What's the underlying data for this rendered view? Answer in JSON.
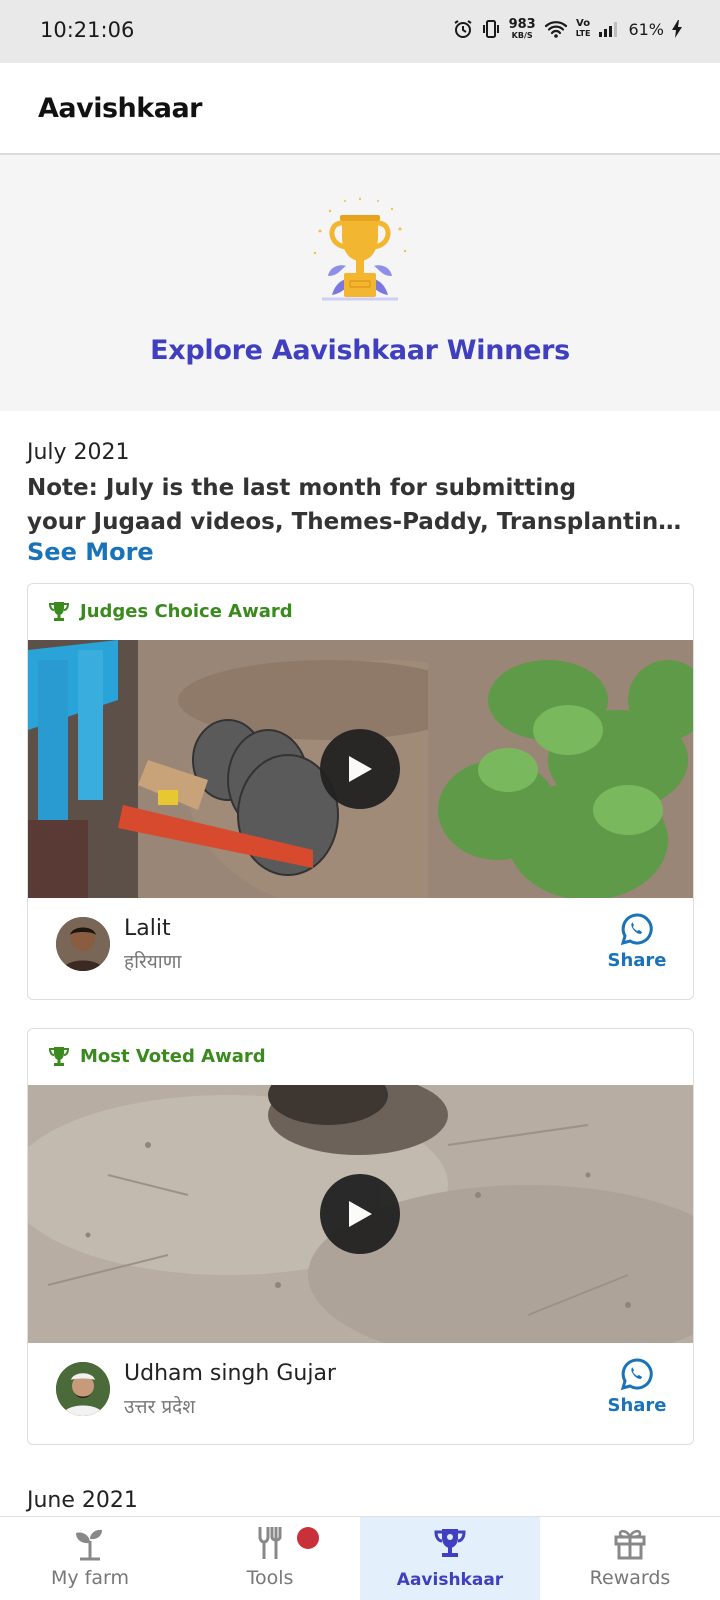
{
  "status_bar": {
    "time": "10:21:06",
    "speed_value": "983",
    "speed_unit": "KB/S",
    "volte_top": "Vo",
    "volte_bottom": "LTE",
    "battery": "61%"
  },
  "app_bar": {
    "title": "Aavishkaar"
  },
  "hero": {
    "link_text": "Explore Aavishkaar Winners"
  },
  "current_month": {
    "label": "July 2021",
    "note_line1": "Note: July is the last month for submitting",
    "note_line2": "your Jugaad videos, Themes-Paddy, Transplanting, C...",
    "see_more": "See More"
  },
  "cards": [
    {
      "award": "Judges Choice Award",
      "user_name": "Lalit",
      "user_place": "हरियाणा",
      "share_label": "Share"
    },
    {
      "award": "Most Voted Award",
      "user_name": "Udham singh Gujar",
      "user_place": "उत्तर प्रदेश",
      "share_label": "Share"
    }
  ],
  "next_month": {
    "label": "June 2021"
  },
  "bottom_nav": {
    "items": [
      {
        "label": "My farm",
        "icon": "sprout-icon"
      },
      {
        "label": "Tools",
        "icon": "tools-icon"
      },
      {
        "label": "Aavishkaar",
        "icon": "trophy-icon"
      },
      {
        "label": "Rewards",
        "icon": "gift-icon"
      }
    ],
    "active": "Aavishkaar"
  },
  "colors": {
    "accent": "#3f3fbf",
    "link": "#1a73b8",
    "award_green": "#3a8a1e",
    "notification_dot": "#c8303a"
  }
}
